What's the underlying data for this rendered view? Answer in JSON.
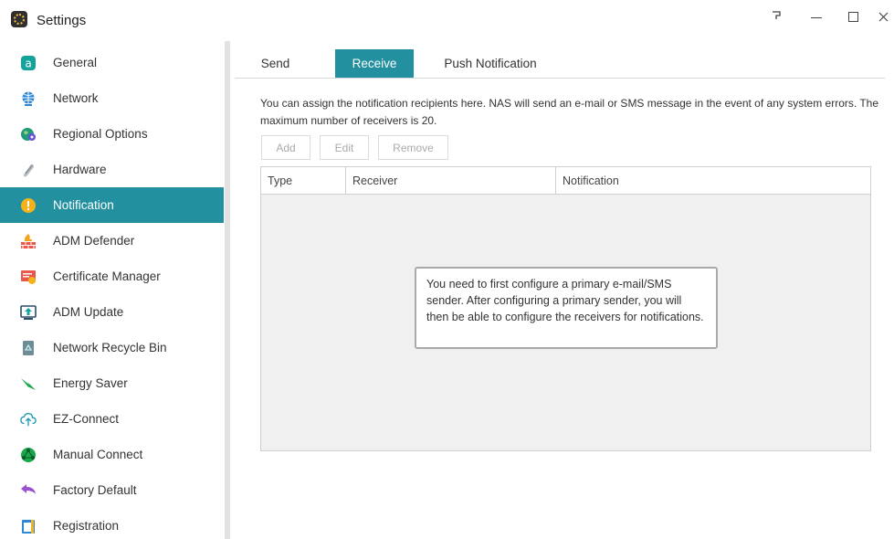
{
  "window": {
    "title": "Settings",
    "app_icon": "settings-gear-icon",
    "controls": {
      "help": "help-icon",
      "minimize": "minimize-icon",
      "maximize": "maximize-icon",
      "close": "close-icon"
    }
  },
  "sidebar": {
    "active_color": "#23909f",
    "items": [
      {
        "label": "General",
        "icon": "general-icon",
        "active": false
      },
      {
        "label": "Network",
        "icon": "globe-icon",
        "active": false
      },
      {
        "label": "Regional Options",
        "icon": "regional-icon",
        "active": false
      },
      {
        "label": "Hardware",
        "icon": "hardware-icon",
        "active": false
      },
      {
        "label": "Notification",
        "icon": "alert-icon",
        "active": true
      },
      {
        "label": "ADM Defender",
        "icon": "firewall-icon",
        "active": false
      },
      {
        "label": "Certificate Manager",
        "icon": "certificate-icon",
        "active": false
      },
      {
        "label": "ADM Update",
        "icon": "update-icon",
        "active": false
      },
      {
        "label": "Network Recycle Bin",
        "icon": "recycle-bin-icon",
        "active": false
      },
      {
        "label": "Energy Saver",
        "icon": "energy-icon",
        "active": false
      },
      {
        "label": "EZ-Connect",
        "icon": "cloud-upload-icon",
        "active": false
      },
      {
        "label": "Manual Connect",
        "icon": "manual-connect-icon",
        "active": false
      },
      {
        "label": "Factory Default",
        "icon": "undo-arrow-icon",
        "active": false
      },
      {
        "label": "Registration",
        "icon": "registration-icon",
        "active": false
      }
    ]
  },
  "main": {
    "tabs": [
      {
        "label": "Send",
        "active": false
      },
      {
        "label": "Receive",
        "active": true
      },
      {
        "label": "Push Notification",
        "active": false
      }
    ],
    "description": "You can assign the notification recipients here. NAS will send an e-mail or SMS message in the event of any system errors. The maximum number of receivers is 20.",
    "buttons": {
      "add": "Add",
      "edit": "Edit",
      "remove": "Remove"
    },
    "table": {
      "columns": [
        "Type",
        "Receiver",
        "Notification"
      ],
      "rows": []
    },
    "tooltip": "You need to first configure a primary e-mail/SMS sender. After configuring a primary sender, you will then be able to configure the receivers for notifications."
  }
}
